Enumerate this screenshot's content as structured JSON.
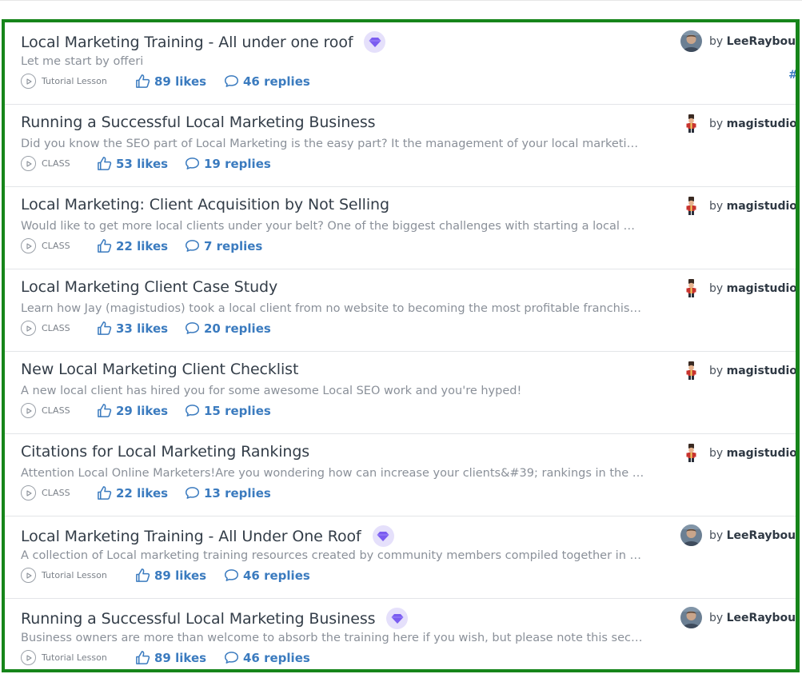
{
  "posts": [
    {
      "title": "Local Marketing Training - All under one roof",
      "premium": true,
      "excerpt": "Let me start by offeri",
      "type": "Tutorial Lesson",
      "likes": "89 likes",
      "replies": "46 replies",
      "author_prefix": "by",
      "author": "LeeRaybould",
      "avatar": "photo",
      "extra": "#"
    },
    {
      "title": "Running a Successful Local Marketing Business",
      "premium": false,
      "excerpt": "Did you know the SEO part of Local Marketing is the easy part? It the management of your local marketing bu...",
      "type": "CLASS",
      "likes": "53 likes",
      "replies": "19 replies",
      "author_prefix": "by",
      "author": "magistudios",
      "avatar": "figure"
    },
    {
      "title": "Local Marketing: Client Acquisition by Not Selling",
      "premium": false,
      "excerpt": "Would like to get more local clients under your belt? One of the biggest challenges with starting a local marke...",
      "type": "CLASS",
      "likes": "22 likes",
      "replies": "7 replies",
      "author_prefix": "by",
      "author": "magistudios",
      "avatar": "figure"
    },
    {
      "title": "Local Marketing Client Case Study",
      "premium": false,
      "excerpt": "Learn how Jay (magistudios) took a local client from no website to becoming the most profitable franchise in t...",
      "type": "CLASS",
      "likes": "33 likes",
      "replies": "20 replies",
      "author_prefix": "by",
      "author": "magistudios",
      "avatar": "figure"
    },
    {
      "title": "New Local Marketing Client Checklist",
      "premium": false,
      "excerpt": "A new local client has hired you for some awesome Local SEO work and you're hyped!",
      "type": "CLASS",
      "likes": "29 likes",
      "replies": "15 replies",
      "author_prefix": "by",
      "author": "magistudios",
      "avatar": "figure"
    },
    {
      "title": "Citations for Local Marketing Rankings",
      "premium": false,
      "excerpt": "Attention Local Online Marketers!Are you wondering how can increase your clients&#39; rankings in the SERP...",
      "type": "CLASS",
      "likes": "22 likes",
      "replies": "13 replies",
      "author_prefix": "by",
      "author": "magistudios",
      "avatar": "figure"
    },
    {
      "title": "Local Marketing Training - All Under One Roof",
      "premium": true,
      "excerpt": "A collection of Local marketing training resources created by community members compiled together in this s...",
      "type": "Tutorial Lesson",
      "likes": "89 likes",
      "replies": "46 replies",
      "author_prefix": "by",
      "author": "LeeRaybould",
      "avatar": "photo"
    },
    {
      "title": "Running a Successful Local Marketing Business",
      "premium": true,
      "excerpt": "Business owners are more than welcome to absorb the training here if you wish, but please note this section i...",
      "type": "Tutorial Lesson",
      "likes": "89 likes",
      "replies": "46 replies",
      "author_prefix": "by",
      "author": "LeeRaybould",
      "avatar": "photo"
    }
  ],
  "icons": {
    "premium": "gem-icon",
    "type": "play-circle-icon",
    "likes": "thumbs-up-icon",
    "replies": "speech-bubble-icon"
  },
  "colors": {
    "accent": "#3b7bbf",
    "gem": "#7a5cf0",
    "frame": "#16851a"
  }
}
